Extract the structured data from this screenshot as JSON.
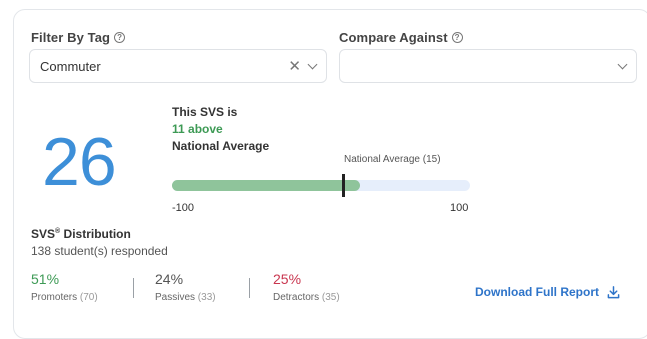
{
  "filters": {
    "tag_label": "Filter By Tag",
    "tag_value": "Commuter",
    "compare_label": "Compare Against",
    "compare_value": ""
  },
  "score": {
    "value": "26",
    "line1": "This SVS is",
    "line2": "11 above",
    "line3": "National Average",
    "national_avg_label": "National Average (15)",
    "bar_min_label": "-100",
    "bar_max_label": "100",
    "bar_min": -100,
    "bar_max": 100,
    "score_value": 26,
    "national_avg_value": 15
  },
  "distribution": {
    "title": "SVS",
    "title_sup": "®",
    "title_rest": " Distribution",
    "subtitle": "138 student(s) responded",
    "metrics": [
      {
        "pct": "51%",
        "label": "Promoters",
        "count": "(70)",
        "color": "#3d9a55"
      },
      {
        "pct": "24%",
        "label": "Passives",
        "count": "(33)",
        "color": "#555555"
      },
      {
        "pct": "25%",
        "label": "Detractors",
        "count": "(35)",
        "color": "#c9364f"
      }
    ]
  },
  "actions": {
    "download_label": "Download Full Report"
  },
  "colors": {
    "accent": "#2e74c9",
    "score": "#3d8fd8",
    "bar_fill": "#8fc49b",
    "bar_track": "#e6eefb"
  }
}
